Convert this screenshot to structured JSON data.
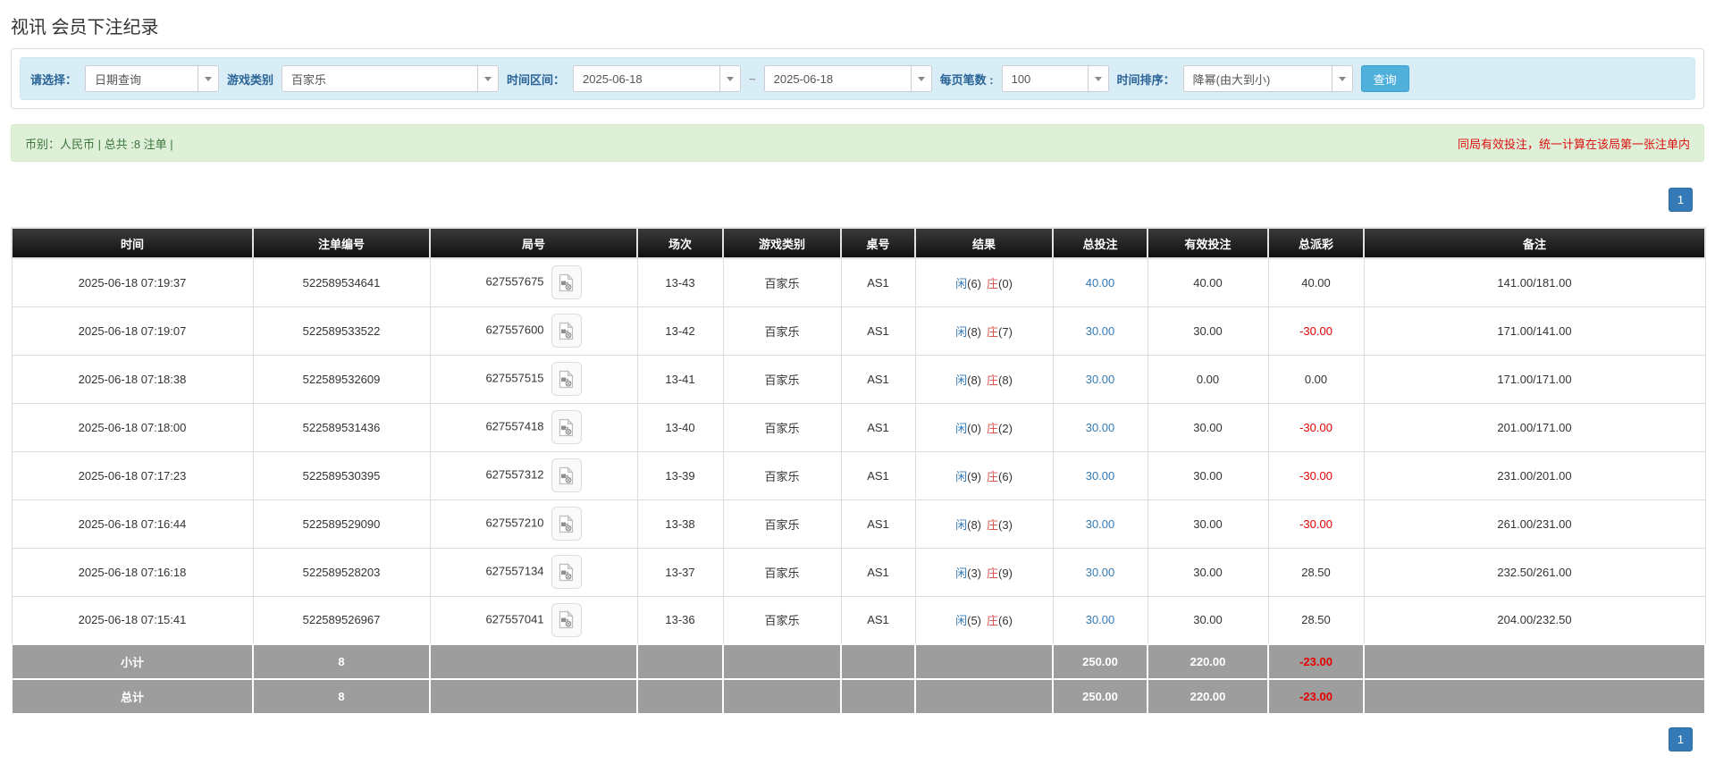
{
  "page": {
    "title": "视讯 会员下注纪录"
  },
  "filters": {
    "select_label": "请选择：",
    "select_value": "日期查询",
    "game_type_label": "游戏类别",
    "game_type_value": "百家乐",
    "time_range_label": "时间区间：",
    "date_from": "2025-06-18",
    "tilde": "~",
    "date_to": "2025-06-18",
    "page_size_label": "每页笔数 :",
    "page_size_value": "100",
    "sort_label": "时间排序：",
    "sort_value": "降幂(由大到小)",
    "search_button": "查询"
  },
  "summary": {
    "left": "币别：人民币 | 总共 :8 注单 |",
    "right": "同局有效投注，统一计算在该局第一张注单内"
  },
  "pagination": {
    "page": "1"
  },
  "table": {
    "headers": [
      "时间",
      "注单编号",
      "局号",
      "场次",
      "游戏类别",
      "桌号",
      "结果",
      "总投注",
      "有效投注",
      "总派彩",
      "备注"
    ],
    "rows": [
      {
        "time": "2025-06-18 07:19:37",
        "bet_id": "522589534641",
        "round": "627557675",
        "session": "13-43",
        "game": "百家乐",
        "table_no": "AS1",
        "player": "闲",
        "player_num": "(6)",
        "banker": "庄",
        "banker_num": "(0)",
        "total_bet": "40.00",
        "valid_bet": "40.00",
        "payout": "40.00",
        "remark": "141.00/181.00"
      },
      {
        "time": "2025-06-18 07:19:07",
        "bet_id": "522589533522",
        "round": "627557600",
        "session": "13-42",
        "game": "百家乐",
        "table_no": "AS1",
        "player": "闲",
        "player_num": "(8)",
        "banker": "庄",
        "banker_num": "(7)",
        "total_bet": "30.00",
        "valid_bet": "30.00",
        "payout": "-30.00",
        "remark": "171.00/141.00"
      },
      {
        "time": "2025-06-18 07:18:38",
        "bet_id": "522589532609",
        "round": "627557515",
        "session": "13-41",
        "game": "百家乐",
        "table_no": "AS1",
        "player": "闲",
        "player_num": "(8)",
        "banker": "庄",
        "banker_num": "(8)",
        "total_bet": "30.00",
        "valid_bet": "0.00",
        "payout": "0.00",
        "remark": "171.00/171.00"
      },
      {
        "time": "2025-06-18 07:18:00",
        "bet_id": "522589531436",
        "round": "627557418",
        "session": "13-40",
        "game": "百家乐",
        "table_no": "AS1",
        "player": "闲",
        "player_num": "(0)",
        "banker": "庄",
        "banker_num": "(2)",
        "total_bet": "30.00",
        "valid_bet": "30.00",
        "payout": "-30.00",
        "remark": "201.00/171.00"
      },
      {
        "time": "2025-06-18 07:17:23",
        "bet_id": "522589530395",
        "round": "627557312",
        "session": "13-39",
        "game": "百家乐",
        "table_no": "AS1",
        "player": "闲",
        "player_num": "(9)",
        "banker": "庄",
        "banker_num": "(6)",
        "total_bet": "30.00",
        "valid_bet": "30.00",
        "payout": "-30.00",
        "remark": "231.00/201.00"
      },
      {
        "time": "2025-06-18 07:16:44",
        "bet_id": "522589529090",
        "round": "627557210",
        "session": "13-38",
        "game": "百家乐",
        "table_no": "AS1",
        "player": "闲",
        "player_num": "(8)",
        "banker": "庄",
        "banker_num": "(3)",
        "total_bet": "30.00",
        "valid_bet": "30.00",
        "payout": "-30.00",
        "remark": "261.00/231.00"
      },
      {
        "time": "2025-06-18 07:16:18",
        "bet_id": "522589528203",
        "round": "627557134",
        "session": "13-37",
        "game": "百家乐",
        "table_no": "AS1",
        "player": "闲",
        "player_num": "(3)",
        "banker": "庄",
        "banker_num": "(9)",
        "total_bet": "30.00",
        "valid_bet": "30.00",
        "payout": "28.50",
        "remark": "232.50/261.00"
      },
      {
        "time": "2025-06-18 07:15:41",
        "bet_id": "522589526967",
        "round": "627557041",
        "session": "13-36",
        "game": "百家乐",
        "table_no": "AS1",
        "player": "闲",
        "player_num": "(5)",
        "banker": "庄",
        "banker_num": "(6)",
        "total_bet": "30.00",
        "valid_bet": "30.00",
        "payout": "28.50",
        "remark": "204.00/232.50"
      }
    ],
    "subtotal": {
      "label": "小计",
      "count": "8",
      "total_bet": "250.00",
      "valid_bet": "220.00",
      "payout": "-23.00"
    },
    "total": {
      "label": "总计",
      "count": "8",
      "total_bet": "250.00",
      "valid_bet": "220.00",
      "payout": "-23.00"
    }
  },
  "icons": {
    "video_replay": "video-file-icon",
    "dropdown": "chevron-down-icon"
  },
  "colors": {
    "accent_blue": "#337ab7",
    "search_button": "#4fb0dc",
    "filter_bg": "#d9edf7",
    "filter_label": "#2a6496",
    "summary_bg": "#dff0d8",
    "summary_text_green": "#3c763d",
    "warning_red": "#dd1111",
    "negative_red": "#e60000",
    "banker_red": "#d9534f",
    "header_bg": "#1a1a1a",
    "footer_grey": "#9d9d9d"
  }
}
